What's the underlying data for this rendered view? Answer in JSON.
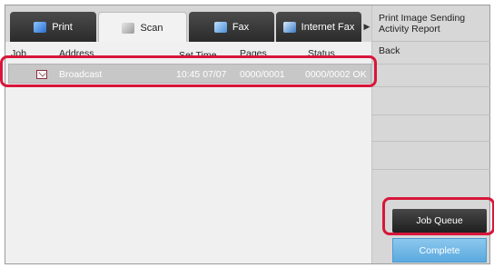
{
  "tabs": [
    {
      "label": "Print",
      "icon": "print-icon"
    },
    {
      "label": "Scan",
      "icon": "scan-icon"
    },
    {
      "label": "Fax",
      "icon": "fax-icon"
    },
    {
      "label": "Internet Fax",
      "icon": "internet-fax-icon"
    }
  ],
  "table": {
    "headers": {
      "job": "Job",
      "address": "Address",
      "set_time": "Set Time",
      "pages": "Pages",
      "status": "Status"
    },
    "rows": [
      {
        "address": "Broadcast",
        "set_time": "10:45 07/07",
        "pages": "0000/0001",
        "status": "0000/0002 OK"
      }
    ]
  },
  "side": {
    "print_report": "Print Image Sending Activity Report",
    "back": "Back",
    "job_queue": "Job Queue",
    "complete": "Complete"
  },
  "colors": {
    "highlight": "#d8163a",
    "complete_button": "#6db6e6",
    "selected_row": "#c7c7c7"
  }
}
